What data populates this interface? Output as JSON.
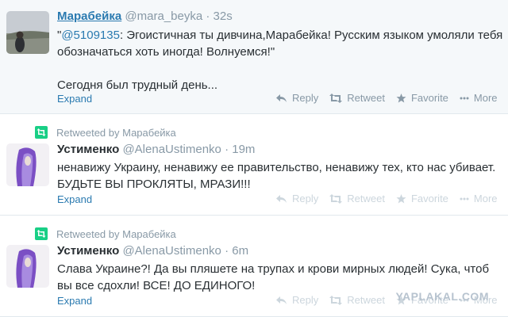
{
  "tweets": [
    {
      "name": "Марабейка",
      "handle": "@mara_beyka",
      "time": "32s",
      "mention": "@5109135",
      "text_after_mention": ": Эгоистичная ты дивчина,Марабейка! Русским языком умоляли тебя обозначаться хоть иногда! Волнуемся!\"",
      "text_prefix": "\"",
      "second_paragraph": "Сегодня был трудный день...",
      "expand": "Expand",
      "reply": "Reply",
      "retweet": "Retweet",
      "favorite": "Favorite",
      "more": "More"
    },
    {
      "retweeted_by": "Retweeted by Марабейка",
      "name": "Устименко",
      "handle": "@AlenaUstimenko",
      "time": "19m",
      "text": "ненавижу Украину, ненавижу ее правительство, ненавижу тех, кто нас убивает. БУДЬТЕ ВЫ ПРОКЛЯТЫ, МРАЗИ!!!",
      "expand": "Expand",
      "reply": "Reply",
      "retweet": "Retweet",
      "favorite": "Favorite",
      "more": "More"
    },
    {
      "retweeted_by": "Retweeted by Марабейка",
      "name": "Устименко",
      "handle": "@AlenaUstimenko",
      "time": "6m",
      "text": "Слава Украине?! Да вы пляшете на трупах и крови мирных людей! Сука, чтоб вы все сдохли! ВСЕ! ДО ЕДИНОГО!",
      "expand": "Expand",
      "reply": "Reply",
      "retweet": "Retweet",
      "favorite": "Favorite",
      "more": "More"
    }
  ],
  "separator_dot": "·",
  "watermark": "YAPLAKAL.COM",
  "colors": {
    "link": "#2a7ab0",
    "muted": "#8899a6",
    "retweet_green": "#19cf86",
    "selected_bg": "#f5f8fa"
  },
  "icons": {
    "reply": "reply-arrow-icon",
    "retweet": "retweet-icon",
    "favorite": "star-icon",
    "more": "ellipsis-icon",
    "retweeted_badge": "retweet-badge-icon"
  }
}
